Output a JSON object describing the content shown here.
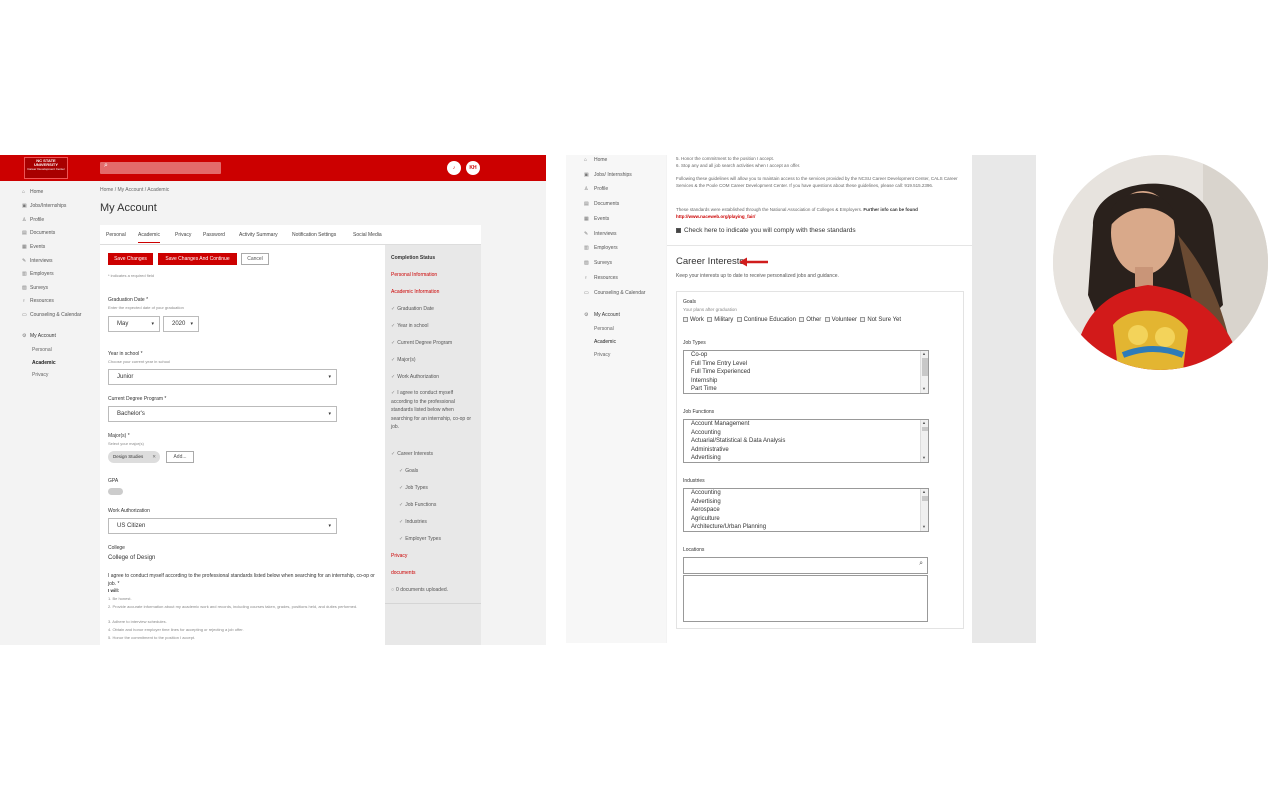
{
  "left": {
    "logo": {
      "line1": "NC STATE UNIVERSITY",
      "line2": "Career Development Center"
    },
    "header": {
      "avatar_initials": "KH",
      "notif_icon": "bell-icon"
    },
    "sidebar": {
      "items": [
        {
          "icon": "⌂",
          "label": "Home"
        },
        {
          "icon": "▣",
          "label": "Jobs/Internships"
        },
        {
          "icon": "♙",
          "label": "Profile"
        },
        {
          "icon": "▤",
          "label": "Documents"
        },
        {
          "icon": "▦",
          "label": "Events"
        },
        {
          "icon": "✎",
          "label": "Interviews"
        },
        {
          "icon": "▥",
          "label": "Employers"
        },
        {
          "icon": "▧",
          "label": "Surveys"
        },
        {
          "icon": "♀",
          "label": "Resources"
        },
        {
          "icon": "▭",
          "label": "Counseling & Calendar"
        },
        {
          "icon": "⚙",
          "label": "My Account"
        }
      ],
      "sub": [
        "Personal",
        "Academic",
        "Privacy"
      ]
    },
    "breadcrumb": "Home / My Account / Academic",
    "title": "My Account",
    "tabs": [
      "Personal",
      "Academic",
      "Privacy",
      "Password",
      "Activity Summary",
      "Notification Settings",
      "Social Media"
    ],
    "buttons": {
      "save": "Save Changes",
      "save_continue": "Save Changes And Continue",
      "cancel": "Cancel"
    },
    "required_note": "* indicates a required field",
    "graduation": {
      "label": "Graduation Date *",
      "hint": "Enter the expected date of your graduation",
      "month": "May",
      "year": "2020"
    },
    "year_school": {
      "label": "Year in school *",
      "hint": "Choose your current year in school",
      "value": "Junior"
    },
    "degree": {
      "label": "Current Degree Program *",
      "value": "Bachelor's"
    },
    "majors": {
      "label": "Major(s) *",
      "hint": "Select your major(s)",
      "chip": "Design Studies",
      "add": "Add..."
    },
    "gpa": {
      "label": "GPA"
    },
    "work_auth": {
      "label": "Work Authorization",
      "value": "US Citizen"
    },
    "college": {
      "label": "College",
      "value": "College of Design"
    },
    "agree": {
      "text": "I agree to conduct myself according to the professional standards listed below when searching for an internship, co-op or job. *",
      "will": "I will:",
      "items": [
        "1. Be honest.",
        "2. Provide accurate information about my academic work and records, including courses taken, grades, positions held, and duties performed.",
        "3. Adhere to interview schedules.",
        "4. Obtain and honor employer time lines for accepting or rejecting a job offer.",
        "5. Honor the commitment to the position I accept."
      ]
    },
    "completion": {
      "title": "Completion Status",
      "items": [
        "Personal Information",
        "Academic Information",
        "Graduation Date",
        "Year in school",
        "Current Degree Program",
        "Major(s)",
        "Work Authorization",
        "I agree to conduct myself according to the professional standards listed below when searching for an internship, co-op or job.",
        "Career Interests",
        "Goals",
        "Job Types",
        "Job Functions",
        "Industries",
        "Employer Types",
        "Privacy",
        "documents",
        "0 documents uploaded."
      ]
    }
  },
  "middle": {
    "sidebar": {
      "items": [
        {
          "icon": "⌂",
          "label": "Home"
        },
        {
          "icon": "▣",
          "label": "Jobs/ Internships"
        },
        {
          "icon": "♙",
          "label": "Profile"
        },
        {
          "icon": "▤",
          "label": "Documents"
        },
        {
          "icon": "▦",
          "label": "Events"
        },
        {
          "icon": "✎",
          "label": "Interviews"
        },
        {
          "icon": "▥",
          "label": "Employers"
        },
        {
          "icon": "▧",
          "label": "Surveys"
        },
        {
          "icon": "♀",
          "label": "Resources"
        },
        {
          "icon": "▭",
          "label": "Counseling & Calendar"
        },
        {
          "icon": "⚙",
          "label": "My Account"
        }
      ],
      "sub": [
        "Personal",
        "Academic",
        "Privacy"
      ]
    },
    "top_text": {
      "line5": "5. Honor the commitment to the position I accept.",
      "line6": "6. Stop any and all job search activities when I accept an offer.",
      "para1": "Following these guidelines will allow you to maintain access to the services provided by the NCSU Career Development Center, CALS Career Services & the Poole COM Career Development Center. If you have questions about these guidelines, please call: 919.515.2396.",
      "para2a": "These standards were established through the National Association of Colleges & Employers.",
      "para2b": "Further info can be found",
      "link": "http://www.naceweb.org/playing_fair/",
      "checkbox": "Check here to indicate you will comply with these standards"
    },
    "career": {
      "title": "Career Interests",
      "subtitle": "Keep your interests up to date to receive personalized jobs and guidance.",
      "goals_label": "Goals",
      "goals_hint": "Your plans after graduation",
      "goals": [
        "Work",
        "Military",
        "Continue Education",
        "Other",
        "Volunteer",
        "Not Sure Yet"
      ],
      "job_types_label": "Job Types",
      "job_types": [
        "Co-op",
        "Full Time Entry Level",
        "Full Time Experienced",
        "Internship",
        "Part Time"
      ],
      "job_functions_label": "Job Functions",
      "job_functions": [
        "Account Management",
        "Accounting",
        "Actuarial/Statistical & Data Analysis",
        "Administrative",
        "Advertising"
      ],
      "industries_label": "Industries",
      "industries": [
        "Accounting",
        "Advertising",
        "Aerospace",
        "Agriculture",
        "Architecture/Urban Planning"
      ],
      "locations_label": "Locations"
    }
  },
  "colors": {
    "brand_red": "#cc0000",
    "arrow_red": "#d01c1c"
  }
}
